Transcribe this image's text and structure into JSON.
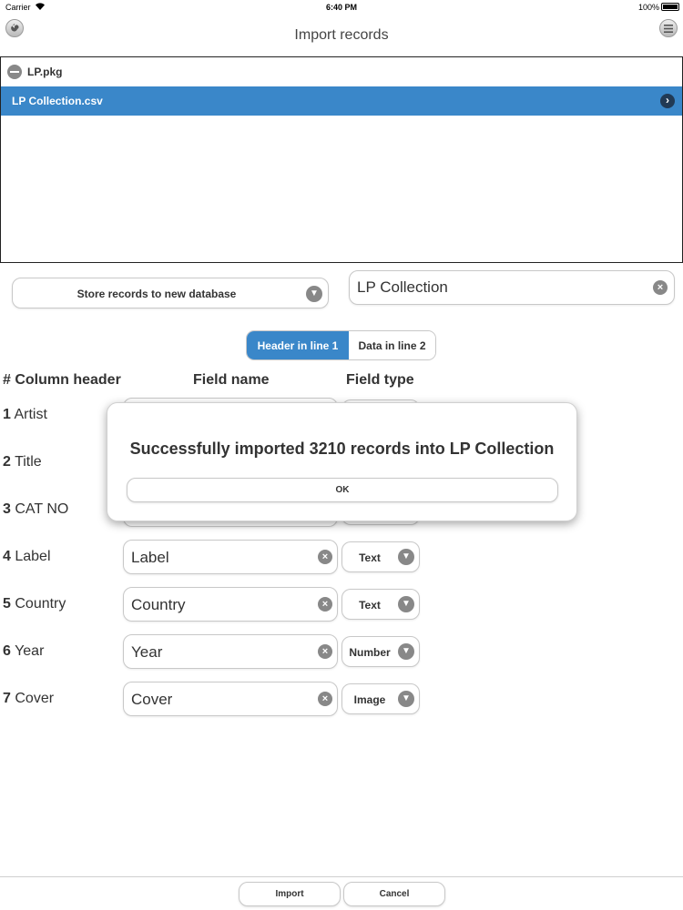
{
  "status_bar": {
    "carrier": "Carrier",
    "time": "6:40 PM",
    "battery": "100%"
  },
  "header": {
    "title": "Import records"
  },
  "file_list": {
    "package": "LP.pkg",
    "selected_file": "LP Collection.csv"
  },
  "store_select": {
    "label": "Store records to new database"
  },
  "database_name": {
    "value": "LP Collection"
  },
  "segmented": {
    "option1": "Header in line 1",
    "option2": "Data in line 2",
    "selected": "Header in line 1"
  },
  "columns": {
    "col_header": "# Column header",
    "field_name": "Field name",
    "field_type": "Field type"
  },
  "rows": [
    {
      "num": "1",
      "header": "Artist",
      "field": "",
      "type": ""
    },
    {
      "num": "2",
      "header": "Title",
      "field": "",
      "type": ""
    },
    {
      "num": "3",
      "header": "CAT NO",
      "field": "",
      "type": ""
    },
    {
      "num": "4",
      "header": "Label",
      "field": "Label",
      "type": "Text"
    },
    {
      "num": "5",
      "header": "Country",
      "field": "Country",
      "type": "Text"
    },
    {
      "num": "6",
      "header": "Year",
      "field": "Year",
      "type": "Number"
    },
    {
      "num": "7",
      "header": "Cover",
      "field": "Cover",
      "type": "Image"
    }
  ],
  "modal": {
    "message": "Successfully imported 3210 records into LP Collection",
    "ok_label": "OK"
  },
  "footer": {
    "import_label": "Import",
    "cancel_label": "Cancel"
  },
  "colors": {
    "accent": "#3a87c9",
    "chevron_dark": "#213a55"
  }
}
